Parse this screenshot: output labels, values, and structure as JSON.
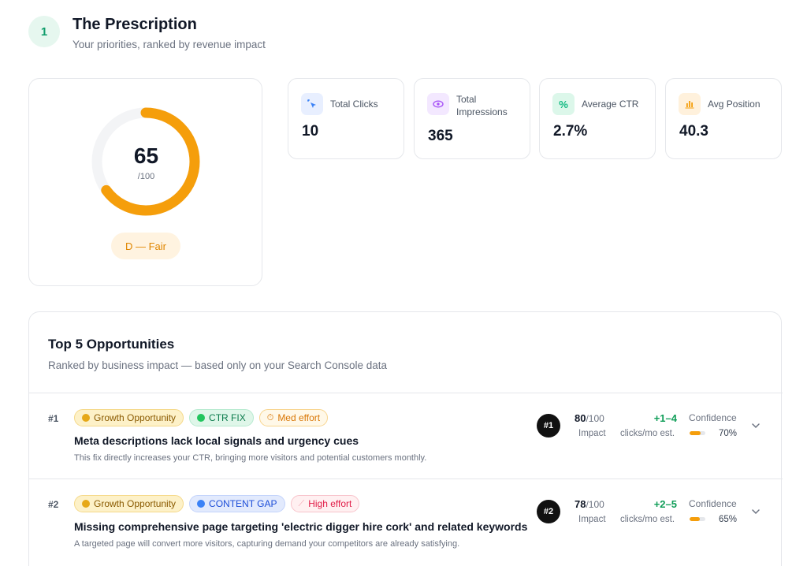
{
  "header": {
    "step": "1",
    "title": "The Prescription",
    "subtitle": "Your priorities, ranked by revenue impact"
  },
  "score": {
    "value": "65",
    "max_label": "/100",
    "fraction": 0.65,
    "grade": "D — Fair",
    "color": "#f59e0b"
  },
  "metrics": [
    {
      "label": "Total Clicks",
      "value": "10",
      "icon": "cursor-click-icon",
      "color": "#3b82f6"
    },
    {
      "label": "Total Impressions",
      "value": "365",
      "icon": "eye-icon",
      "color": "#a855f7"
    },
    {
      "label": "Average CTR",
      "value": "2.7%",
      "icon": "percent-icon",
      "color": "#10b981"
    },
    {
      "label": "Avg Position",
      "value": "40.3",
      "icon": "bar-chart-icon",
      "color": "#f59e0b"
    }
  ],
  "opportunities": {
    "title": "Top 5 Opportunities",
    "subtitle": "Ranked by business impact — based only on your Search Console data",
    "items": [
      {
        "rank": "#1",
        "tags": [
          "Growth Opportunity",
          "CTR FIX",
          "Med effort"
        ],
        "title": "Meta descriptions lack local signals and urgency cues",
        "description": "This fix directly increases your CTR, bringing more visitors and potential customers monthly.",
        "badge": "#1",
        "impact": "80",
        "impact_max": "/100",
        "impact_label": "Impact",
        "clicks": "+1–4",
        "clicks_label": "clicks/mo est.",
        "confidence_label": "Confidence",
        "confidence": "70%",
        "confidence_fraction": 0.7
      },
      {
        "rank": "#2",
        "tags": [
          "Growth Opportunity",
          "CONTENT GAP",
          "High effort"
        ],
        "title": "Missing comprehensive page targeting 'electric digger hire cork' and related keywords",
        "description": "A targeted page will convert more visitors, capturing demand your competitors are already satisfying.",
        "badge": "#2",
        "impact": "78",
        "impact_max": "/100",
        "impact_label": "Impact",
        "clicks": "+2–5",
        "clicks_label": "clicks/mo est.",
        "confidence_label": "Confidence",
        "confidence": "65%",
        "confidence_fraction": 0.65
      }
    ]
  }
}
